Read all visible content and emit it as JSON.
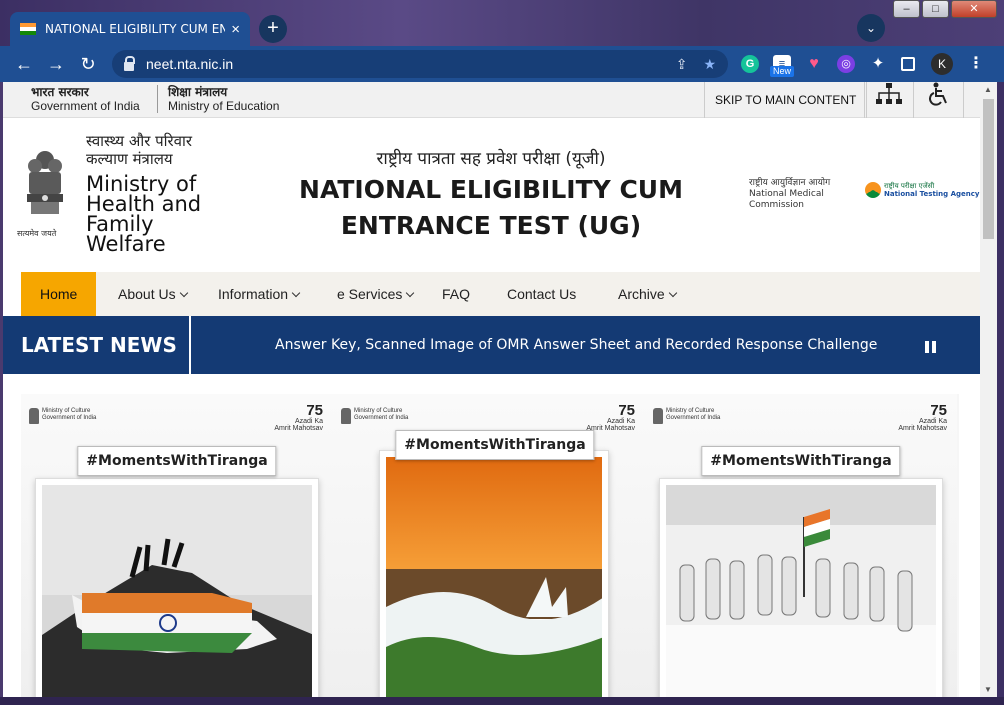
{
  "browser": {
    "tab_title": "NATIONAL ELIGIBILITY CUM ENT",
    "tab_close": "×",
    "new_tab": "+",
    "tab_search": "⌄",
    "url": "neet.nta.nic.in",
    "new_badge": "New",
    "profile_initial": "K",
    "menu": "⋮"
  },
  "gov_strip": {
    "gov_hi": "भारत सरकार",
    "gov_en": "Government of India",
    "moe_hi": "शिक्षा मंत्रालय",
    "moe_en": "Ministry of Education",
    "skip": "SKIP TO MAIN CONTENT"
  },
  "header": {
    "ministry_hi_1": "स्वास्थ्य और परिवार",
    "ministry_hi_2": "कल्याण मंत्रालय",
    "ministry_en_1": "Ministry of",
    "ministry_en_2": "Health and",
    "ministry_en_3": "Family",
    "ministry_en_4": "Welfare",
    "emblem_caption": "सत्यमेव जयते",
    "title_hi": "राष्ट्रीय पात्रता सह प्रवेश परीक्षा (यूजी)",
    "title_en_1": "NATIONAL ELIGIBILITY CUM",
    "title_en_2": "ENTRANCE TEST (UG)",
    "nmc_hi": "राष्ट्रीय आयुर्विज्ञान आयोग",
    "nmc_en_1": "National Medical",
    "nmc_en_2": "Commission",
    "nta_hi": "राष्ट्रीय परीक्षा एजेंसी",
    "nta_en": "National Testing Agency"
  },
  "nav": {
    "items": [
      "Home",
      "About Us",
      "Information",
      "e Services",
      "FAQ",
      "Contact Us",
      "Archive"
    ],
    "active": "Home"
  },
  "news": {
    "label": "LATEST NEWS",
    "ticker": "Answer Key, Scanned Image of OMR Answer Sheet and Recorded Response Challenge"
  },
  "banner": {
    "ministry_line_1": "Ministry of Culture",
    "ministry_line_2": "Government of India",
    "aka_number": "75",
    "aka_line_1": "Azadi",
    "aka_line_2": "Ka",
    "aka_line_3": "Amrit Mahotsav",
    "hashtag": "#MomentsWithTiranga"
  },
  "colors": {
    "chrome_blue": "#1f4f93",
    "news_bar": "#143a74",
    "nav_active": "#f6a600",
    "saffron": "#f7931e",
    "india_green": "#138808"
  }
}
